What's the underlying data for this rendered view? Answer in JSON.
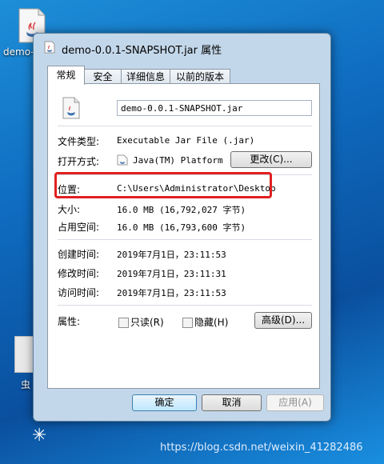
{
  "desktop": {
    "icon_label": "demo-",
    "icon2_label": "虫"
  },
  "window": {
    "title": "demo-0.0.1-SNAPSHOT.jar 属性",
    "tabs": [
      {
        "label": "常规"
      },
      {
        "label": "安全"
      },
      {
        "label": "详细信息"
      },
      {
        "label": "以前的版本"
      }
    ]
  },
  "general": {
    "file_name": "demo-0.0.1-SNAPSHOT.jar",
    "type_label": "文件类型:",
    "type_value": "Executable Jar File (.jar)",
    "open_with_label": "打开方式:",
    "open_with_value": "Java(TM) Platform S",
    "change_button": "更改(C)...",
    "location_label": "位置:",
    "location_value": "C:\\Users\\Administrator\\Desktop",
    "size_label": "大小:",
    "size_value": "16.0 MB (16,792,027 字节)",
    "disk_size_label": "占用空间:",
    "disk_size_value": "16.0 MB (16,793,600 字节)",
    "created_label": "创建时间:",
    "created_value": "2019年7月1日，23:11:53",
    "modified_label": "修改时间:",
    "modified_value": "2019年7月1日，23:11:31",
    "accessed_label": "访问时间:",
    "accessed_value": "2019年7月1日，23:11:53",
    "attributes_label": "属性:",
    "readonly_label": "只读(R)",
    "hidden_label": "隐藏(H)",
    "advanced_button": "高级(D)..."
  },
  "footer": {
    "ok": "确定",
    "cancel": "取消",
    "apply": "应用(A)"
  },
  "watermark": "https://blog.csdn.net/weixin_41282486",
  "colors": {
    "highlight": "#e02020",
    "panel_bg": "#ffffff",
    "window_frame": "#c3d7ea"
  }
}
